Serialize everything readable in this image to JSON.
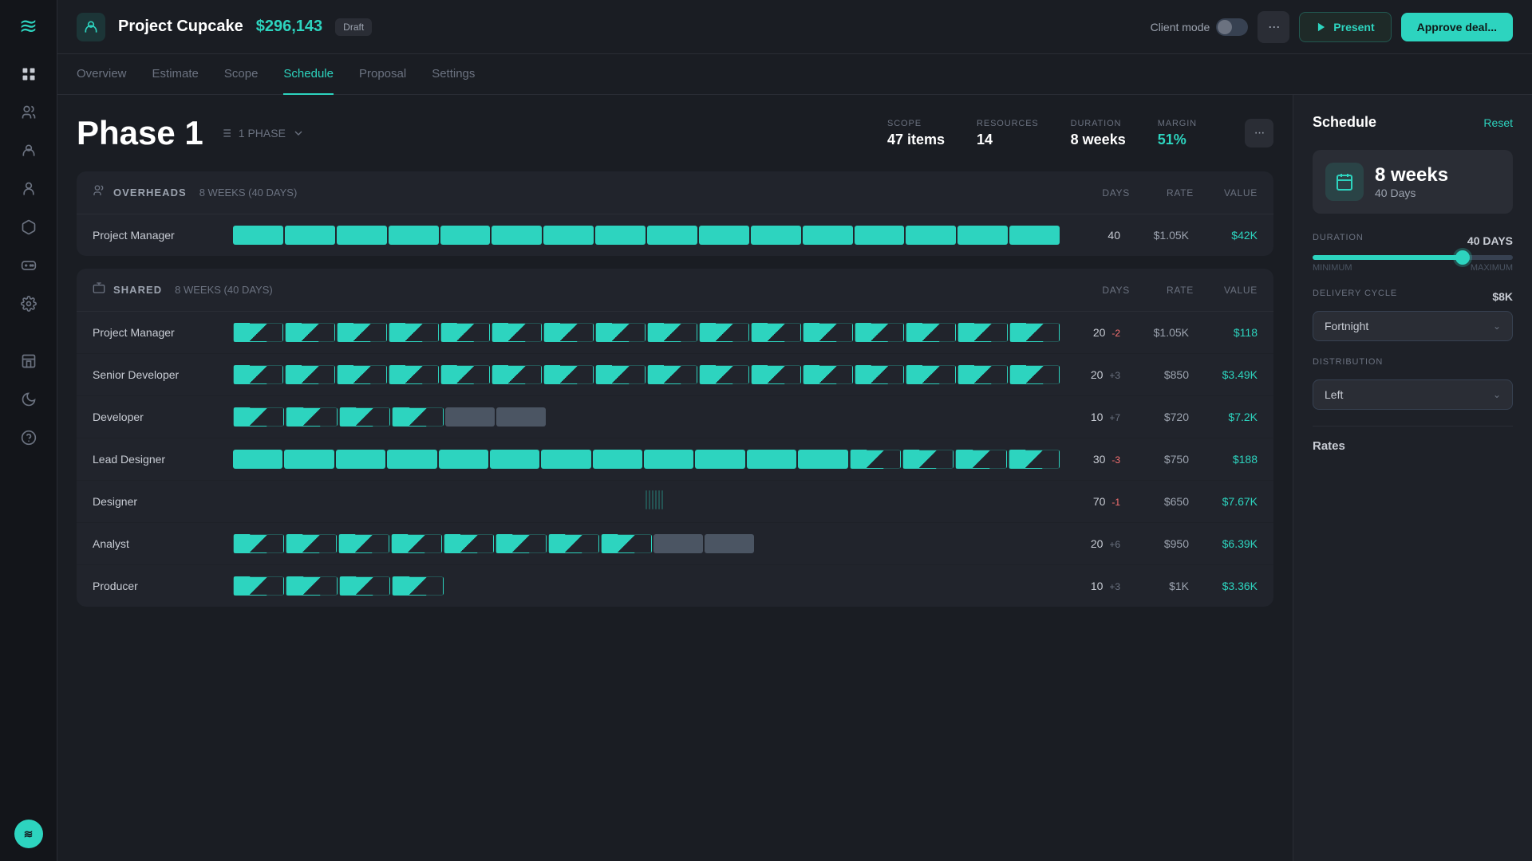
{
  "app": {
    "logo": "≋"
  },
  "sidebar": {
    "icons": [
      {
        "name": "grid-icon",
        "symbol": "⊞",
        "active": false
      },
      {
        "name": "users-icon",
        "symbol": "👥",
        "active": false
      },
      {
        "name": "person-icon",
        "symbol": "👤",
        "active": false
      },
      {
        "name": "team-icon",
        "symbol": "🫂",
        "active": false
      },
      {
        "name": "cube-icon",
        "symbol": "◆",
        "active": false
      },
      {
        "name": "game-icon",
        "symbol": "🎮",
        "active": false
      },
      {
        "name": "settings-icon",
        "symbol": "⚙",
        "active": false
      },
      {
        "name": "building-icon",
        "symbol": "🏢",
        "active": false
      },
      {
        "name": "moon-icon",
        "symbol": "☽",
        "active": false
      },
      {
        "name": "help-icon",
        "symbol": "?",
        "active": false
      }
    ],
    "bottom_logo": "≋"
  },
  "header": {
    "project_icon": "👤",
    "project_name": "Project Cupcake",
    "project_budget": "$296,143",
    "draft_label": "Draft",
    "client_mode_label": "Client mode",
    "more_label": "···",
    "present_label": "Present",
    "approve_label": "Approve deal..."
  },
  "nav": {
    "tabs": [
      {
        "id": "overview",
        "label": "Overview",
        "active": false
      },
      {
        "id": "estimate",
        "label": "Estimate",
        "active": false
      },
      {
        "id": "scope",
        "label": "Scope",
        "active": false
      },
      {
        "id": "schedule",
        "label": "Schedule",
        "active": true
      },
      {
        "id": "proposal",
        "label": "Proposal",
        "active": false
      },
      {
        "id": "settings",
        "label": "Settings",
        "active": false
      }
    ]
  },
  "phase": {
    "title": "Phase 1",
    "phase_count": "1 PHASE",
    "scope_label": "SCOPE",
    "scope_value": "47 items",
    "resources_label": "RESOURCES",
    "resources_value": "14",
    "duration_label": "DURATION",
    "duration_value": "8 weeks",
    "margin_label": "MARGIN",
    "margin_value": "51%"
  },
  "overheads_section": {
    "icon": "👥",
    "title": "OVERHEADS",
    "duration": "8 WEEKS (40 DAYS)",
    "days_col": "DAYS",
    "rate_col": "RATE",
    "value_col": "VALUE",
    "rows": [
      {
        "name": "Project Manager",
        "days": "40",
        "delta": "",
        "rate": "$1.05K",
        "value": "$42K",
        "segments": [
          1,
          1,
          1,
          1,
          1,
          1,
          1,
          1,
          1,
          1,
          1,
          1,
          1,
          1,
          1,
          1
        ]
      }
    ]
  },
  "shared_section": {
    "icon": "👥",
    "title": "SHARED",
    "duration": "8 WEEKS (40 DAYS)",
    "days_col": "DAYS",
    "rate_col": "RATE",
    "value_col": "VALUE",
    "rows": [
      {
        "name": "Project Manager",
        "days": "20",
        "delta": "-2",
        "delta_type": "neg",
        "rate": "$1.05K",
        "value": "$118",
        "segments": [
          2,
          2,
          2,
          2,
          2,
          2,
          2,
          2,
          2,
          2,
          2,
          2,
          2,
          2,
          2,
          2
        ]
      },
      {
        "name": "Senior Developer",
        "days": "20",
        "delta": "+3",
        "delta_type": "pos",
        "rate": "$850",
        "value": "$3.49K",
        "segments": [
          2,
          2,
          2,
          2,
          2,
          2,
          2,
          2,
          2,
          2,
          2,
          2,
          2,
          2,
          2,
          2
        ]
      },
      {
        "name": "Developer",
        "days": "10",
        "delta": "+7",
        "delta_type": "pos",
        "rate": "$720",
        "value": "$7.2K",
        "segments": [
          2,
          2,
          2,
          2,
          0,
          0,
          0,
          0,
          0,
          0,
          0,
          0,
          0,
          0,
          0,
          0
        ]
      },
      {
        "name": "Lead Designer",
        "days": "30",
        "delta": "-3",
        "delta_type": "neg",
        "rate": "$750",
        "value": "$188",
        "segments": [
          1,
          1,
          1,
          1,
          1,
          1,
          1,
          1,
          1,
          1,
          1,
          1,
          2,
          2,
          2,
          2
        ]
      },
      {
        "name": "Designer",
        "days": "70",
        "delta": "-1",
        "delta_type": "neg",
        "rate": "$650",
        "value": "$7.67K",
        "segments": [
          1,
          1,
          1,
          1,
          1,
          1,
          1,
          1,
          1,
          1,
          2,
          2,
          2,
          2,
          2,
          2
        ]
      },
      {
        "name": "Analyst",
        "days": "20",
        "delta": "+6",
        "delta_type": "pos",
        "rate": "$950",
        "value": "$6.39K",
        "segments": [
          2,
          2,
          2,
          2,
          2,
          2,
          2,
          2,
          0,
          0,
          0,
          0,
          0,
          0,
          0,
          0
        ]
      },
      {
        "name": "Producer",
        "days": "10",
        "delta": "+3",
        "delta_type": "pos",
        "rate": "$1K",
        "value": "$3.36K",
        "segments": [
          2,
          2,
          2,
          2,
          0,
          0,
          0,
          0,
          0,
          0,
          0,
          0,
          0,
          0,
          0,
          0
        ]
      }
    ]
  },
  "right_panel": {
    "title": "Schedule",
    "reset_label": "Reset",
    "duration_weeks": "8 weeks",
    "duration_days": "40 Days",
    "duration_label": "DURATION",
    "duration_days_value": "40 DAYS",
    "slider_percent": 75,
    "minimum_label": "MINIMUM",
    "maximum_label": "MAXIMUM",
    "delivery_cycle_label": "DELIVERY CYCLE",
    "delivery_cycle_value": "$8K",
    "delivery_cycle_option": "Fortnight",
    "distribution_label": "DISTRIBUTION",
    "distribution_option": "Left",
    "rates_label": "Rates"
  }
}
